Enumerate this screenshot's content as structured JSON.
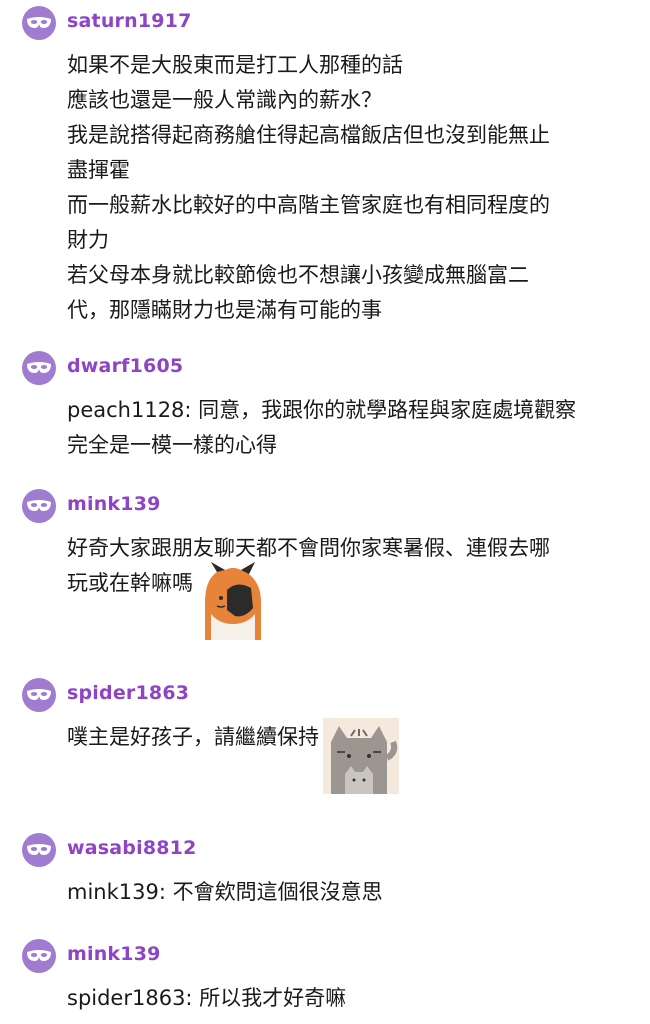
{
  "comments": [
    {
      "username": "saturn1917",
      "lines": [
        "如果不是大股東而是打工人那種的話",
        "應該也還是一般人常識內的薪水？",
        "我是說搭得起商務艙住得起高檔飯店但也沒到能無止",
        "盡揮霍",
        "而一般薪水比較好的中高階主管家庭也有相同程度的",
        "財力",
        "若父母本身就比較節儉也不想讓小孩變成無腦富二",
        "代，那隱瞞財力也是滿有可能的事"
      ]
    },
    {
      "username": "dwarf1605",
      "lines": [
        "peach1128: 同意，我跟你的就學路程與家庭處境觀察",
        "完全是一模一樣的心得"
      ]
    },
    {
      "username": "mink139",
      "lines": [
        "好奇大家跟朋友聊天都不會問你家寒暑假、連假去哪",
        "玩或在幹嘛嗎"
      ],
      "sticker": "fox-facepalm-sticker"
    },
    {
      "username": "spider1863",
      "lines": [
        "噗主是好孩子，請繼續保持"
      ],
      "sticker": "pusheen-cat-sticker"
    },
    {
      "username": "wasabi8812",
      "lines": [
        "mink139: 不會欸問這個很沒意思"
      ]
    },
    {
      "username": "mink139",
      "lines": [
        "spider1863: 所以我才好奇嘛"
      ]
    }
  ],
  "colors": {
    "username": "#8e44c4",
    "avatar": "#a07cd0",
    "text": "#1a1a1a"
  },
  "icons": {
    "avatar": "anonymous-mask-icon"
  }
}
